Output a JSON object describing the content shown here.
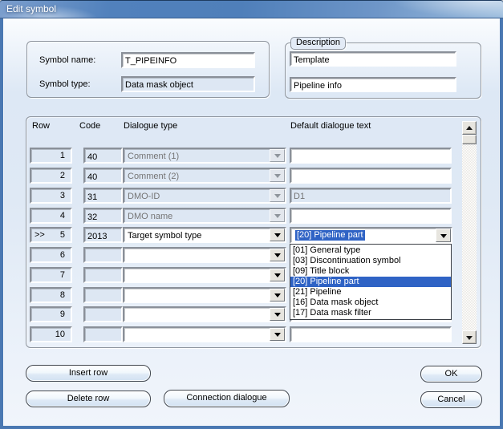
{
  "window": {
    "title": "Edit symbol"
  },
  "symbol": {
    "name_label": "Symbol name:",
    "name_value": "T_PIPEINFO",
    "type_label": "Symbol type:",
    "type_value": "Data mask object"
  },
  "description": {
    "label": "Description",
    "line1": "Template",
    "line2": "Pipeline info"
  },
  "grid": {
    "headers": {
      "row": "Row",
      "code": "Code",
      "type": "Dialogue type",
      "text": "Default dialogue text"
    },
    "rows": [
      {
        "marker": "",
        "num": "1",
        "code": "40",
        "type": "Comment (1)",
        "text": ""
      },
      {
        "marker": "",
        "num": "2",
        "code": "40",
        "type": "Comment (2)",
        "text": ""
      },
      {
        "marker": "",
        "num": "3",
        "code": "31",
        "type": "DMO-ID",
        "text": "D1"
      },
      {
        "marker": "",
        "num": "4",
        "code": "32",
        "type": "DMO name",
        "text": ""
      },
      {
        "marker": ">>",
        "num": "5",
        "code": "2013",
        "type": "Target symbol type",
        "text": "[20] Pipeline part"
      },
      {
        "marker": "",
        "num": "6",
        "code": "",
        "type": "",
        "text": ""
      },
      {
        "marker": "",
        "num": "7",
        "code": "",
        "type": "",
        "text": ""
      },
      {
        "marker": "",
        "num": "8",
        "code": "",
        "type": "",
        "text": ""
      },
      {
        "marker": "",
        "num": "9",
        "code": "",
        "type": "",
        "text": ""
      },
      {
        "marker": "",
        "num": "10",
        "code": "",
        "type": "",
        "text": ""
      }
    ]
  },
  "dropdown": {
    "selected": "[20] Pipeline part",
    "items": [
      "[01] General type",
      "[03] Discontinuation symbol",
      "[09] Title block",
      "[20] Pipeline part",
      "[21] Pipeline",
      "[16] Data mask object",
      "[17] Data mask filter"
    ]
  },
  "buttons": {
    "insert_row": "Insert row",
    "delete_row": "Delete row",
    "connection_dialogue": "Connection dialogue",
    "ok": "OK",
    "cancel": "Cancel"
  },
  "colors": {
    "selection": "#2f63c5",
    "titlebar_blue": "#5181bc",
    "frame_blue": "#4a78b2",
    "field_disabled_bg": "#dde7f3",
    "disabled_text": "#757575"
  }
}
